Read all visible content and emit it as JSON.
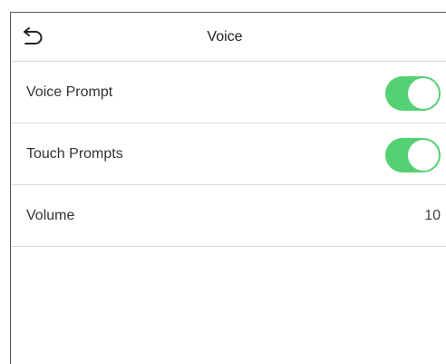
{
  "header": {
    "title": "Voice",
    "back_icon": "back-arrow-icon"
  },
  "settings": {
    "voice_prompt": {
      "label": "Voice Prompt",
      "enabled": true
    },
    "touch_prompts": {
      "label": "Touch Prompts",
      "enabled": true
    },
    "volume": {
      "label": "Volume",
      "value": "10"
    }
  },
  "colors": {
    "toggle_on": "#53d173",
    "divider": "#d9d9d9"
  }
}
